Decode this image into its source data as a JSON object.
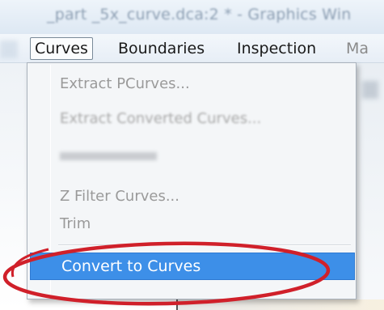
{
  "window": {
    "title": "_part _5x_curve.dca:2 * - Graphics Win"
  },
  "menubar": {
    "items": [
      {
        "label": "Curves",
        "active": true
      },
      {
        "label": "Boundaries",
        "active": false
      },
      {
        "label": "Inspection",
        "active": false
      },
      {
        "label": "Ma",
        "active": false
      }
    ]
  },
  "dropdown": {
    "items": [
      {
        "label": "Extract PCurves...",
        "enabled": false
      },
      {
        "label": "Extract Converted Curves...",
        "enabled": false
      },
      {
        "label": "Z Filter Curves...",
        "enabled": false
      },
      {
        "label": "Trim",
        "enabled": false
      },
      {
        "label": "Convert to Curves",
        "enabled": true,
        "highlighted": true
      }
    ]
  },
  "colors": {
    "highlight": "#3d8fe8",
    "disabled_text": "#9a9a9a",
    "annotation": "#d0202a"
  }
}
